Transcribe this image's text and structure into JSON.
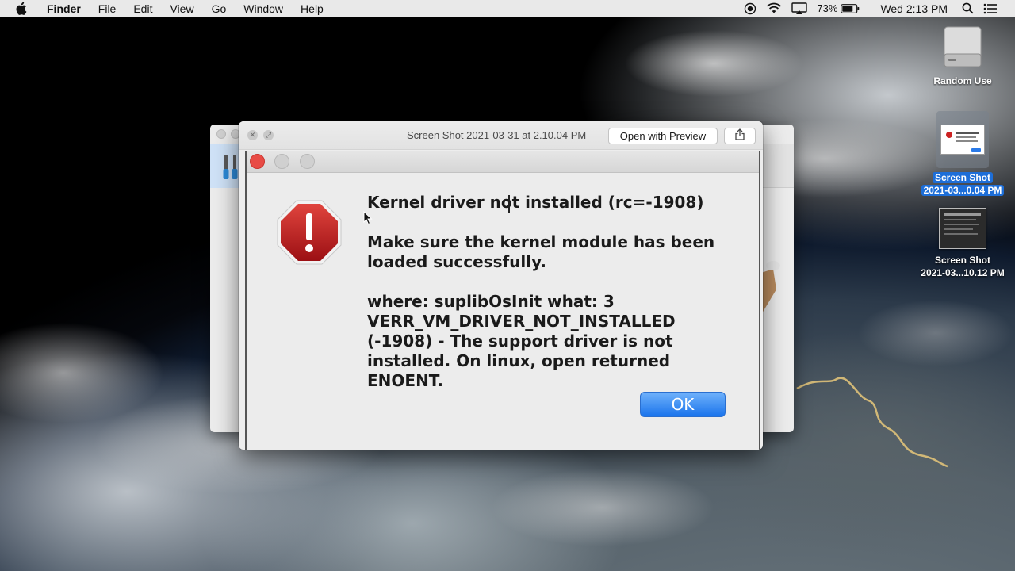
{
  "menubar": {
    "app_name": "Finder",
    "items": [
      "File",
      "Edit",
      "View",
      "Go",
      "Window",
      "Help"
    ],
    "battery": "73%",
    "clock": "Wed 2:13 PM"
  },
  "desktop": {
    "icons": [
      {
        "label": "Random Use",
        "type": "drive-icon"
      },
      {
        "label_line1": "Screen Shot",
        "label_line2": "2021-03...0.04 PM",
        "selected": true
      },
      {
        "label_line1": "Screen Shot",
        "label_line2": "2021-03...10.12 PM",
        "selected": false
      }
    ]
  },
  "quicklook": {
    "title": "Screen Shot 2021-03-31 at 2.10.04 PM",
    "open_with_label": "Open with Preview"
  },
  "alert": {
    "title": "Kernel driver not installed (rc=-1908)",
    "message": "Make sure the kernel module has been loaded successfully.",
    "details": "where: suplibOsInit what: 3 VERR_VM_DRIVER_NOT_INSTALLED (-1908) - The support driver is not installed. On linux, open returned ENOENT.",
    "ok_label": "OK",
    "icon": "stop-icon"
  },
  "colors": {
    "accent_blue": "#1a74ec",
    "alert_red": "#b7191d",
    "selection_blue": "#1d6ed8"
  }
}
